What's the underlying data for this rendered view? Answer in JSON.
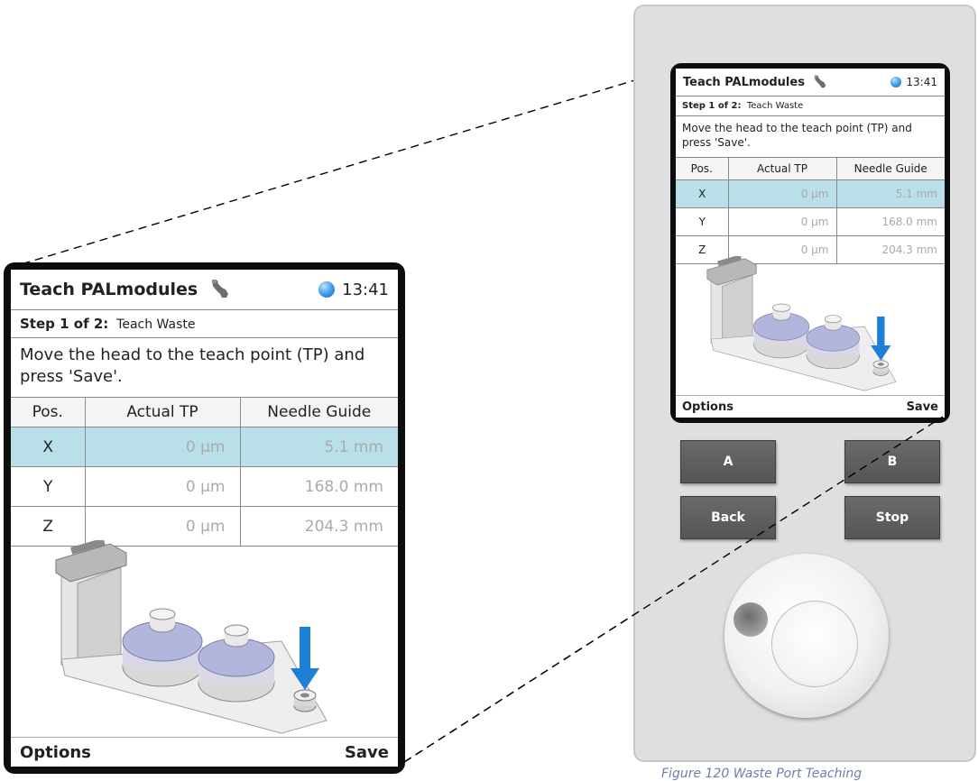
{
  "screen": {
    "title": "Teach PALmodules",
    "time": "13:41",
    "step_label": "Step 1 of 2:",
    "step_name": "Teach Waste",
    "instruction": "Move the head to the teach point (TP) and press 'Save'.",
    "table": {
      "headers": [
        "Pos.",
        "Actual TP",
        "Needle Guide"
      ],
      "rows": [
        {
          "pos": "X",
          "actual": "0 µm",
          "guide": "5.1 mm",
          "selected": true
        },
        {
          "pos": "Y",
          "actual": "0 µm",
          "guide": "168.0 mm",
          "selected": false
        },
        {
          "pos": "Z",
          "actual": "0 µm",
          "guide": "204.3 mm",
          "selected": false
        }
      ]
    },
    "footer": {
      "left": "Options",
      "right": "Save"
    }
  },
  "device": {
    "button_a": "A",
    "button_b": "B",
    "button_back": "Back",
    "button_stop": "Stop"
  },
  "caption": "Figure 120 Waste Port Teaching",
  "colors": {
    "selected_row": "#b9dfe9",
    "arrow": "#1f7fd4",
    "device_button": "#5f5f5f"
  }
}
